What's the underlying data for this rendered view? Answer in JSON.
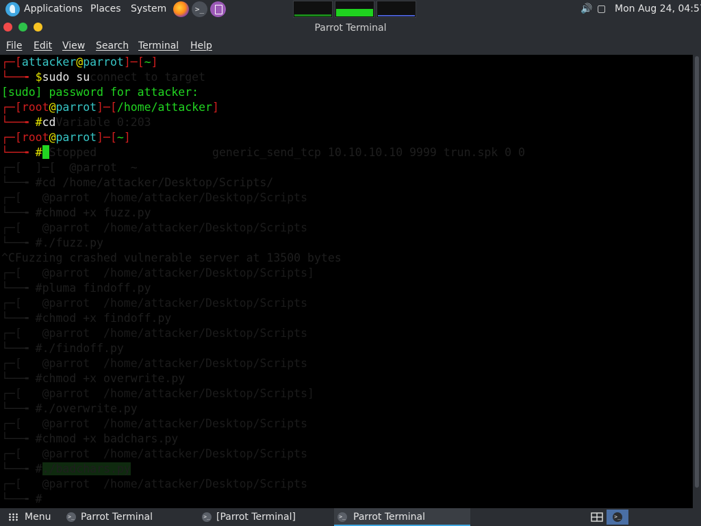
{
  "top_panel": {
    "applications": "Applications",
    "places": "Places",
    "system": "System",
    "clock": "Mon Aug 24, 04:57",
    "icons": [
      "parrot-logo-icon",
      "firefox-icon",
      "terminal-launcher-icon",
      "text-editor-icon",
      "volume-icon",
      "display-icon"
    ],
    "monitors": [
      {
        "name": "cpu-monitor",
        "level": 0.15,
        "color": "#1a8a1a"
      },
      {
        "name": "memory-monitor",
        "level": 0.5,
        "color": "#1fd21f"
      },
      {
        "name": "network-monitor",
        "level": 0.1,
        "color": "#4a5fd0"
      }
    ]
  },
  "window": {
    "title": "Parrot Terminal"
  },
  "menubar": {
    "file": "File",
    "edit": "Edit",
    "view": "View",
    "search": "Search",
    "terminal": "Terminal",
    "help": "Help"
  },
  "terminal": {
    "prompt1": {
      "left": "┌─[",
      "user": "attacker",
      "at": "@",
      "host": "parrot",
      "mid": "]─[",
      "path": "~",
      "right": "]"
    },
    "cmd1": {
      "prefix": "└──╼ ",
      "sigil": "$",
      "command": "sudo su",
      "residue": "connect to target"
    },
    "sudo_prompt": "[sudo] password for attacker:",
    "prompt2": {
      "left": "┌─[",
      "user": "root",
      "at": "@",
      "host": "parrot",
      "mid": "]─[",
      "path": "/home/attacker",
      "right": "]"
    },
    "cmd2": {
      "prefix": "└──╼ ",
      "sigil": "#",
      "command": "cd",
      "residue": "Variable 0:203"
    },
    "prompt3": {
      "left": "┌─[",
      "user": "root",
      "at": "@",
      "host": "parrot",
      "mid": "]─[",
      "path": "~",
      "right": "]"
    },
    "cmd3": {
      "prefix": "└──╼ ",
      "sigil": "#",
      "residue": "Stopped                 generic_send_tcp 10.10.10.10 9999 trun.spk 0 0"
    },
    "ghost_lines": [
      "┌─[  ]─[  @parrot  ~",
      "└──╼ #cd /home/attacker/Desktop/Scripts/",
      "┌─[   @parrot  /home/attacker/Desktop/Scripts",
      "└──╼ #chmod +x fuzz.py",
      "┌─[   @parrot  /home/attacker/Desktop/Scripts",
      "└──╼ #./fuzz.py",
      "^CFuzzing crashed vulnerable server at 13500 bytes",
      "┌─[   @parrot  /home/attacker/Desktop/Scripts]",
      "└──╼ #pluma findoff.py",
      "┌─[   @parrot  /home/attacker/Desktop/Scripts",
      "└──╼ #chmod +x findoff.py",
      "┌─[   @parrot  /home/attacker/Desktop/Scripts",
      "└──╼ #./findoff.py",
      "┌─[   @parrot  /home/attacker/Desktop/Scripts",
      "└──╼ #chmod +x overwrite.py",
      "┌─[   @parrot  /home/attacker/Desktop/Scripts]",
      "└──╼ #./overwrite.py",
      "┌─[   @parrot  /home/attacker/Desktop/Scripts",
      "└──╼ #chmod +x badchars.py",
      "┌─[   @parrot  /home/attacker/Desktop/Scripts",
      "└──╼ #",
      "┌─[   @parrot  /home/attacker/Desktop/Scripts",
      "└──╼ #"
    ],
    "highlighted_ghost": "./badchars.py"
  },
  "taskbar": {
    "menu_label": "Menu",
    "tasks": [
      {
        "label": "Parrot Terminal",
        "active": false
      },
      {
        "label": "[Parrot Terminal]",
        "active": false
      },
      {
        "label": "Parrot Terminal",
        "active": true
      }
    ],
    "tray_icons": [
      "workspace-switcher-icon",
      "terminal-tray-icon"
    ]
  }
}
